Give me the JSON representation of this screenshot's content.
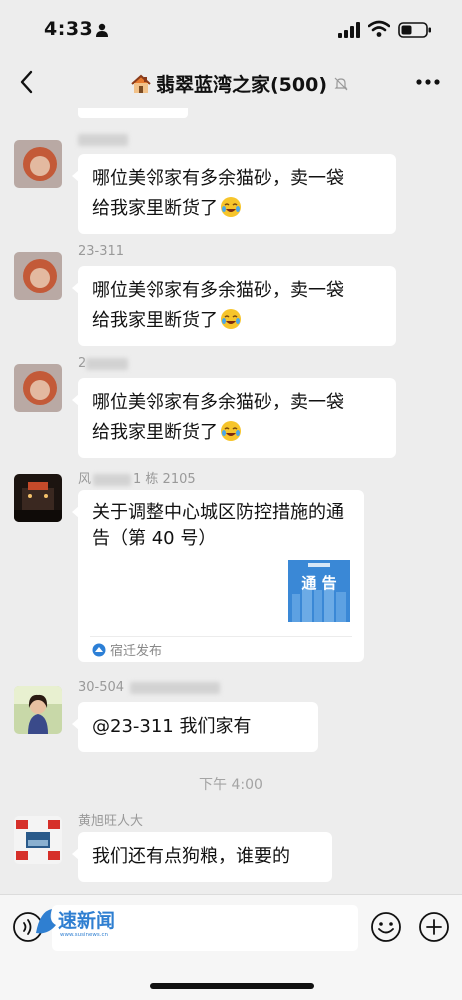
{
  "status_bar": {
    "time": "4:33"
  },
  "header": {
    "title": "翡翠蓝湾之家(500)"
  },
  "messages": [
    {
      "sender": "",
      "text_line1": "哪位美邻家有多余猫砂，卖一袋",
      "text_line2": "给我家里断货了"
    },
    {
      "sender": "23-311",
      "text_line1": "哪位美邻家有多余猫砂，卖一袋",
      "text_line2": "给我家里断货了"
    },
    {
      "sender": "2",
      "text_line1": "哪位美邻家有多余猫砂，卖一袋",
      "text_line2": "给我家里断货了"
    },
    {
      "sender": "风",
      "sender_suffix": "1 栋 2105",
      "card_title": "关于调整中心城区防控措施的通告（第 40 号）",
      "card_thumb_text": "通 告",
      "card_source": "宿迁发布"
    },
    {
      "sender": "30-504",
      "text": "@23-311 我们家有"
    },
    {
      "sender": "黄旭旺人大",
      "text": "我们还有点狗粮，谁要的"
    }
  ],
  "time_divider": "下午 4:00",
  "input_bar": {
    "watermark": "速新闻",
    "watermark_sub": "www.susinews.cn"
  },
  "colors": {
    "background": "#ededed",
    "bubble": "#ffffff",
    "card_thumb": "#3a88d6"
  }
}
